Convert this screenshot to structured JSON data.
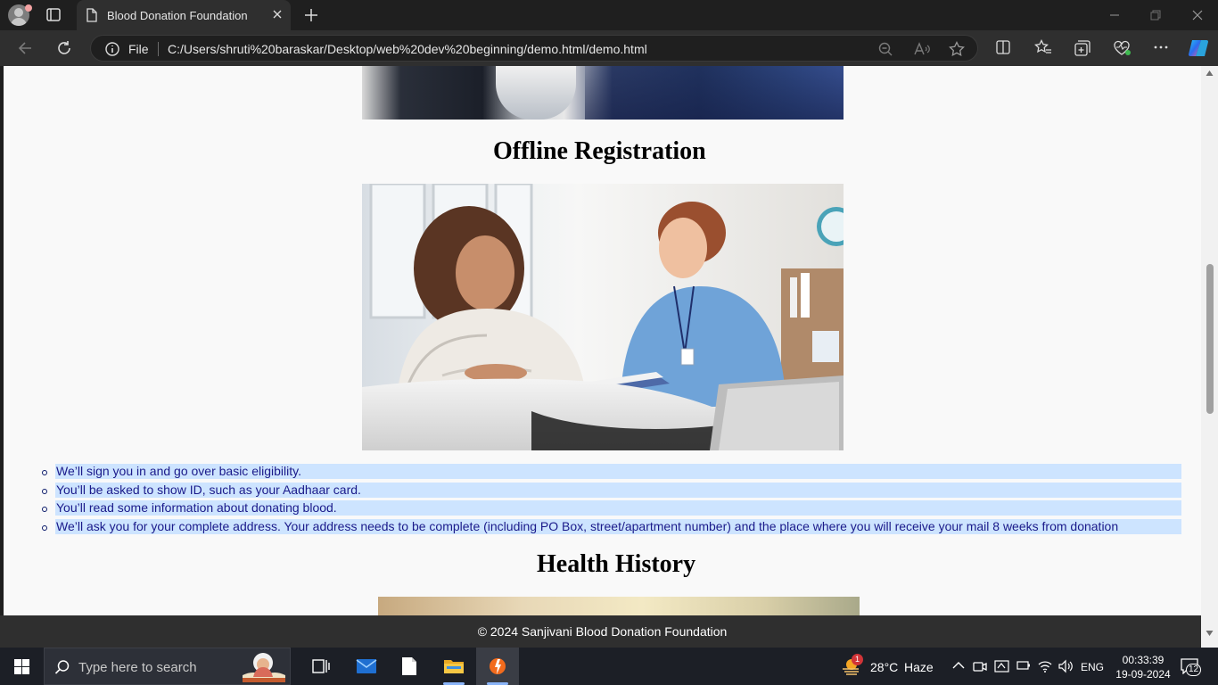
{
  "browser": {
    "tab_title": "Blood Donation Foundation",
    "address_scheme_label": "File",
    "url": "C:/Users/shruti%20baraskar/Desktop/web%20dev%20beginning/demo.html/demo.html"
  },
  "page": {
    "offline_title": "Offline Registration",
    "steps": [
      "We’ll sign you in and go over basic eligibility.",
      "You’ll be asked to show ID, such as your Aadhaar card.",
      "You’ll read some information about donating blood.",
      "We’ll ask you for your complete address. Your address needs to be complete (including PO Box, street/apartment number) and the place where you will receive your mail 8 weeks from donation"
    ],
    "health_title": "Health History",
    "footer": "© 2024 Sanjivani Blood Donation Foundation"
  },
  "taskbar": {
    "search_placeholder": "Type here to search",
    "weather_badge": "1",
    "temperature": "28°C",
    "weather": "Haze",
    "language": "ENG",
    "time": "00:33:39",
    "date": "19-09-2024",
    "notification_count": "12"
  },
  "colors": {
    "selection": "#cde4ff",
    "footer_bg": "#2f2f2f",
    "page_bg": "#f9f9f9"
  }
}
